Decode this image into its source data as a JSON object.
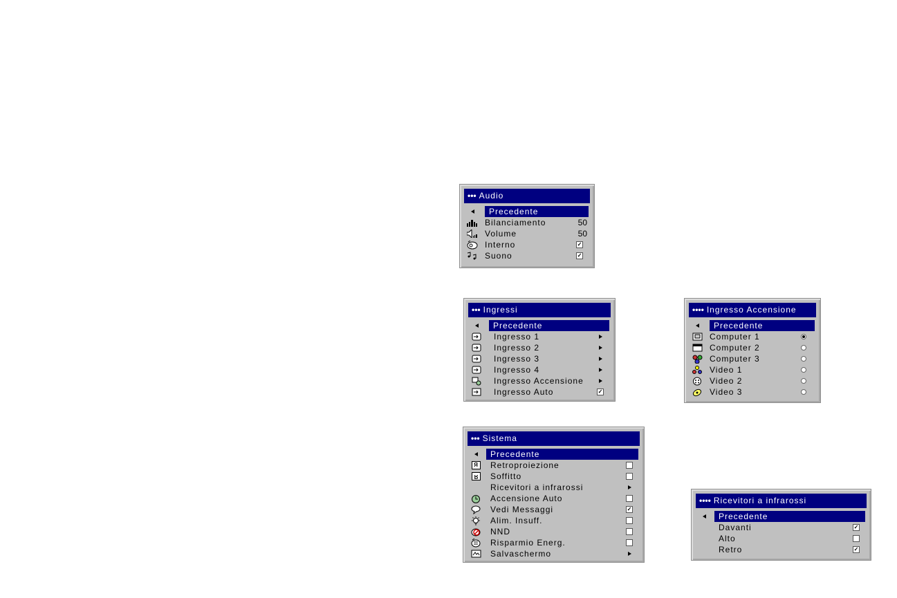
{
  "audio": {
    "title": "Audio",
    "back": "Precedente",
    "items": [
      {
        "label": "Bilanciamento",
        "value": "50",
        "icon": "balance-icon"
      },
      {
        "label": "Volume",
        "value": "50",
        "icon": "speaker-icon"
      },
      {
        "label": "Interno",
        "checked": true,
        "icon": "internal-speaker-icon"
      },
      {
        "label": "Suono",
        "checked": true,
        "icon": "music-note-icon"
      }
    ]
  },
  "ingressi": {
    "title": "Ingressi",
    "back": "Precedente",
    "items": [
      {
        "label": "Ingresso 1",
        "icon": "input-icon"
      },
      {
        "label": "Ingresso 2",
        "icon": "input-icon"
      },
      {
        "label": "Ingresso 3",
        "icon": "input-icon"
      },
      {
        "label": "Ingresso 4",
        "icon": "input-icon"
      },
      {
        "label": "Ingresso Accensione",
        "icon": "power-input-icon"
      },
      {
        "label": "Ingresso Auto",
        "checked": true,
        "icon": "auto-input-icon"
      }
    ]
  },
  "ingresso_accensione": {
    "title": "Ingresso Accensione",
    "back": "Precedente",
    "items": [
      {
        "label": "Computer 1",
        "selected": true,
        "icon": "computer-icon"
      },
      {
        "label": "Computer 2",
        "selected": false,
        "icon": "monitor-icon"
      },
      {
        "label": "Computer 3",
        "selected": false,
        "icon": "component-icon"
      },
      {
        "label": "Video 1",
        "selected": false,
        "icon": "rca-icon"
      },
      {
        "label": "Video 2",
        "selected": false,
        "icon": "svideo-icon"
      },
      {
        "label": "Video 3",
        "selected": false,
        "icon": "video-icon"
      }
    ]
  },
  "sistema": {
    "title": "Sistema",
    "back": "Precedente",
    "items": [
      {
        "label": "Retroproiezione",
        "checked": false,
        "icon": "rear-projection-icon"
      },
      {
        "label": "Soffitto",
        "checked": false,
        "icon": "ceiling-icon"
      },
      {
        "label": "Ricevitori a infrarossi",
        "submenu": true,
        "icon": ""
      },
      {
        "label": "Accensione Auto",
        "checked": false,
        "icon": "auto-power-icon"
      },
      {
        "label": "Vedi Messaggi",
        "checked": true,
        "icon": "message-icon"
      },
      {
        "label": "Alim. Insuff.",
        "checked": false,
        "icon": "bulb-icon"
      },
      {
        "label": "NND",
        "checked": false,
        "icon": "no-blank-icon"
      },
      {
        "label": "Risparmio Energ.",
        "checked": false,
        "icon": "power-saving-icon"
      },
      {
        "label": "Salvaschermo",
        "submenu": true,
        "icon": "screensaver-icon"
      }
    ]
  },
  "ricevitori": {
    "title": "Ricevitori a infrarossi",
    "back": "Precedente",
    "items": [
      {
        "label": "Davanti",
        "checked": true
      },
      {
        "label": "Alto",
        "checked": false
      },
      {
        "label": "Retro",
        "checked": true
      }
    ]
  },
  "symbols": {
    "dots3": "•••",
    "dots4": "••••",
    "check": "✓"
  }
}
